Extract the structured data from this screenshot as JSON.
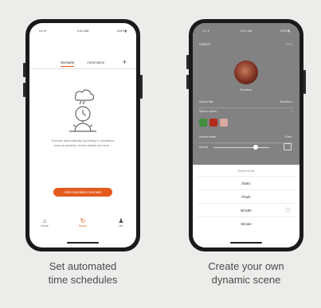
{
  "left_phone": {
    "status": {
      "time_left": "•••• ▾",
      "time_center": "9:41 AM",
      "battery": "100%▮"
    },
    "tabs": [
      {
        "label": "Scenario",
        "active": true
      },
      {
        "label": "Automation",
        "active": false
      }
    ],
    "add_icon": "+",
    "empty_text_line1": "Execute automatically according to conditions",
    "empty_text_line2": "such as weather, device status and time...",
    "cta_label": "Add Automation Scenario",
    "nav": [
      {
        "label": "Home",
        "icon": "home-icon",
        "glyph": "⌂",
        "active": false
      },
      {
        "label": "Scene",
        "icon": "scene-icon",
        "glyph": "↻",
        "active": true
      },
      {
        "label": "Me",
        "icon": "user-icon",
        "glyph": "♟",
        "active": false
      }
    ]
  },
  "right_phone": {
    "status": {
      "time_left": "•••• ▾",
      "time_center": "9:41 AM",
      "battery": "100%▮"
    },
    "cancel_label": "Cancel",
    "save_label": "Save",
    "avatar_label": "Emotion",
    "rows": [
      {
        "label": "Scene title",
        "value": "Emotion ›"
      },
      {
        "label": "Scene colors",
        "value": "+"
      },
      {
        "label": "Scene mode",
        "value": "Flow ›"
      }
    ],
    "slider_label": "Speed",
    "swatch_colors": [
      "#3f8f3f",
      "#b52a1f",
      "#d9a8a0"
    ],
    "sheet_title": "Scene mode",
    "options": [
      {
        "label": "Static",
        "selected": false
      },
      {
        "label": "Flash",
        "selected": false
      },
      {
        "label": "Breath",
        "selected": true
      },
      {
        "label": "Strobe",
        "selected": false
      }
    ]
  },
  "captions": {
    "left_line1": "Set automated",
    "left_line2": "time schedules",
    "right_line1": "Create your own",
    "right_line2": "dynamic scene"
  },
  "colors": {
    "accent": "#e45a1c",
    "frame": "#1a1a1a",
    "background": "#ececea"
  }
}
